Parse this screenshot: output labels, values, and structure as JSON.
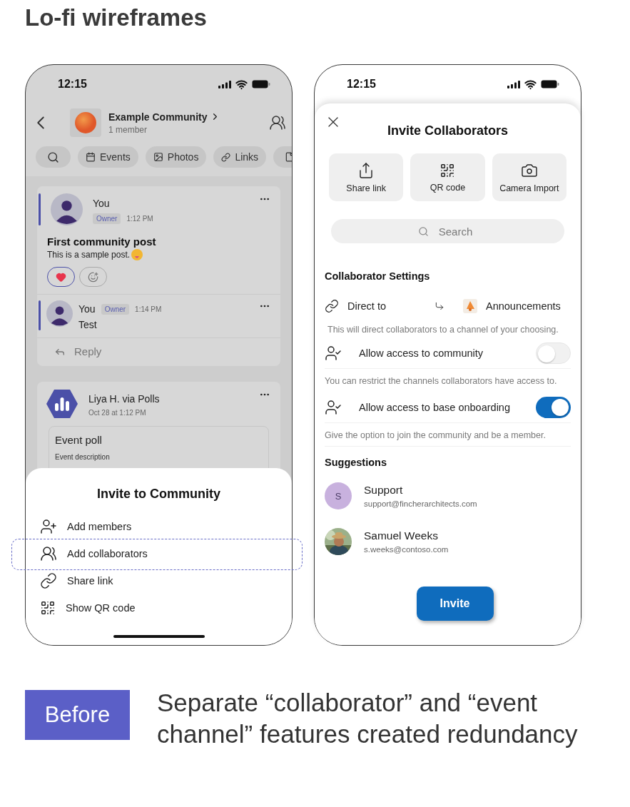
{
  "heading": "Lo-fi wireframes",
  "community_screen": {
    "status_time": "12:15",
    "community": {
      "name": "Example Community",
      "members": "1 member"
    },
    "chips": [
      {
        "kind": "search"
      },
      {
        "kind": "events",
        "label": "Events"
      },
      {
        "kind": "photos",
        "label": "Photos"
      },
      {
        "kind": "links",
        "label": "Links"
      },
      {
        "kind": "files"
      }
    ],
    "post": {
      "author": "You",
      "role": "Owner",
      "time": "1:12 PM",
      "title": "First community post",
      "body": "This is a sample post.",
      "reactions": [
        {
          "kind": "heart",
          "selected": true
        },
        {
          "kind": "add",
          "selected": false
        }
      ],
      "reply": {
        "author": "You",
        "role": "Owner",
        "time": "1:14 PM",
        "body": "Test"
      },
      "reply_label": "Reply"
    },
    "poll_post": {
      "author": "Liya H. via Polls",
      "time": "Oct 28 at 1:12 PM",
      "poll_title": "Event poll",
      "poll_description": "Event description"
    },
    "sheet": {
      "title": "Invite to Community",
      "items": [
        {
          "kind": "add-member",
          "label": "Add members",
          "highlighted": false
        },
        {
          "kind": "add-collaborator",
          "label": "Add collaborators",
          "highlighted": true
        },
        {
          "kind": "link",
          "label": "Share link",
          "highlighted": false
        },
        {
          "kind": "qr",
          "label": "Show QR code",
          "highlighted": false
        }
      ]
    }
  },
  "invite_screen": {
    "status_time": "12:15",
    "title": "Invite Collaborators",
    "actions": [
      {
        "kind": "share",
        "label": "Share link"
      },
      {
        "kind": "qr",
        "label": "QR code"
      },
      {
        "kind": "camera",
        "label": "Camera Import"
      }
    ],
    "search": {
      "placeholder": "Search"
    },
    "settings_title": "Collaborator Settings",
    "direct": {
      "label": "Direct to",
      "channel": "Announcements",
      "note": "This will direct collaborators to a channel of your choosing."
    },
    "toggles": [
      {
        "label": "Allow access to community",
        "on": false,
        "note": "You can restrict the channels collaborators have access to."
      },
      {
        "label": "Allow access to base onboarding",
        "on": true,
        "note": "Give the option to join the community and be a member."
      }
    ],
    "suggestions_title": "Suggestions",
    "suggestions": [
      {
        "kind": "initial",
        "initial": "S",
        "name": "Support",
        "email": "support@fincherarchitects.com"
      },
      {
        "name": "Samuel Weeks",
        "email": "s.weeks@contoso.com"
      }
    ],
    "invite_button": "Invite"
  },
  "footer": {
    "badge": "Before",
    "caption": "Separate “collaborator” and “event channel” features created redundancy"
  }
}
